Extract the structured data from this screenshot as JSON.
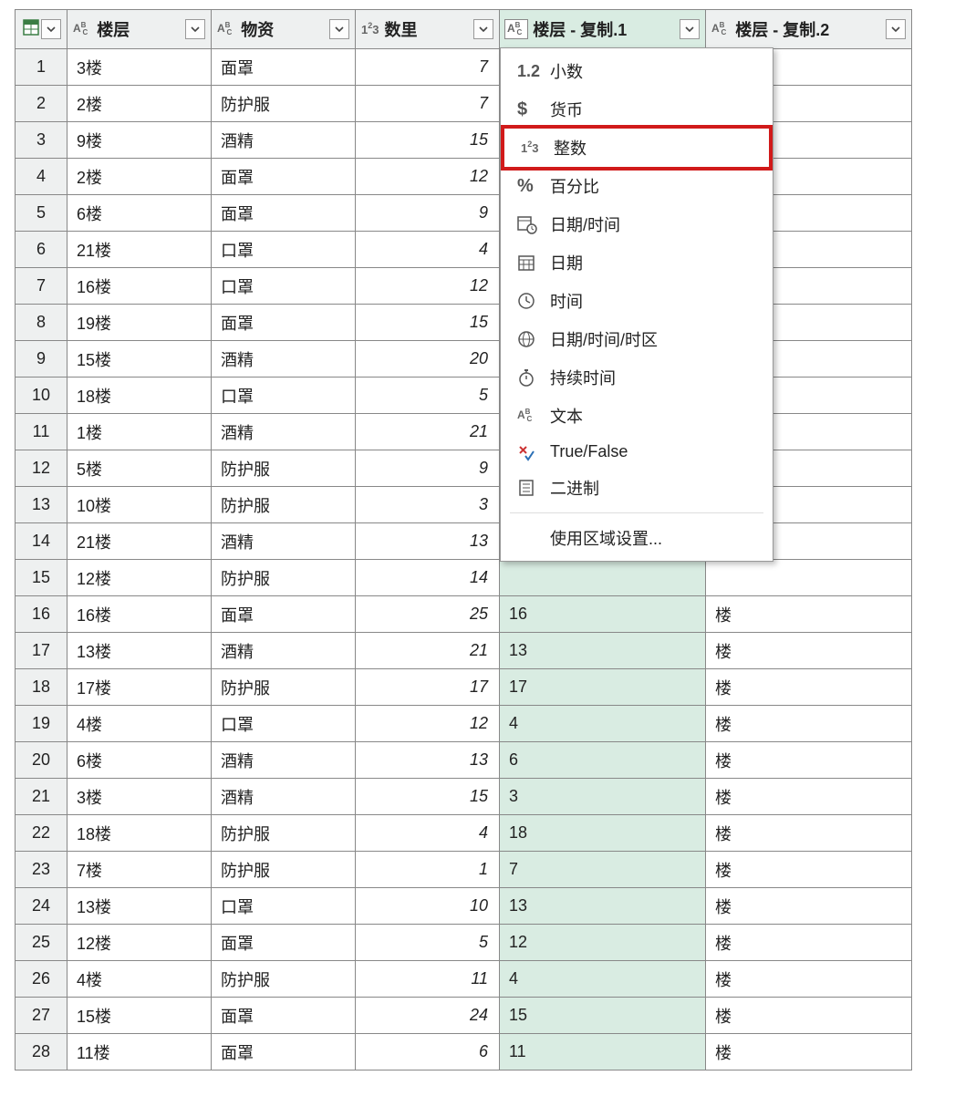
{
  "columns": [
    {
      "id": "rowindex",
      "label": "",
      "type_icon": "table"
    },
    {
      "id": "floor",
      "label": "楼层",
      "type_icon": "abc"
    },
    {
      "id": "supplies",
      "label": "物资",
      "type_icon": "abc"
    },
    {
      "id": "qty",
      "label": "数里",
      "type_icon": "num"
    },
    {
      "id": "floor_c1",
      "label": "楼层 - 复制.1",
      "type_icon": "abc",
      "selected": true,
      "type_picker_open": true
    },
    {
      "id": "floor_c2",
      "label": "楼层 - 复制.2",
      "type_icon": "abc"
    }
  ],
  "rows": [
    {
      "n": 1,
      "floor": "3楼",
      "supplies": "面罩",
      "qty": 7,
      "c1": "",
      "c2": ""
    },
    {
      "n": 2,
      "floor": "2楼",
      "supplies": "防护服",
      "qty": 7,
      "c1": "",
      "c2": ""
    },
    {
      "n": 3,
      "floor": "9楼",
      "supplies": "酒精",
      "qty": 15,
      "c1": "",
      "c2": ""
    },
    {
      "n": 4,
      "floor": "2楼",
      "supplies": "面罩",
      "qty": 12,
      "c1": "",
      "c2": ""
    },
    {
      "n": 5,
      "floor": "6楼",
      "supplies": "面罩",
      "qty": 9,
      "c1": "",
      "c2": ""
    },
    {
      "n": 6,
      "floor": "21楼",
      "supplies": "口罩",
      "qty": 4,
      "c1": "",
      "c2": ""
    },
    {
      "n": 7,
      "floor": "16楼",
      "supplies": "口罩",
      "qty": 12,
      "c1": "",
      "c2": ""
    },
    {
      "n": 8,
      "floor": "19楼",
      "supplies": "面罩",
      "qty": 15,
      "c1": "",
      "c2": ""
    },
    {
      "n": 9,
      "floor": "15楼",
      "supplies": "酒精",
      "qty": 20,
      "c1": "",
      "c2": ""
    },
    {
      "n": 10,
      "floor": "18楼",
      "supplies": "口罩",
      "qty": 5,
      "c1": "",
      "c2": ""
    },
    {
      "n": 11,
      "floor": "1楼",
      "supplies": "酒精",
      "qty": 21,
      "c1": "",
      "c2": ""
    },
    {
      "n": 12,
      "floor": "5楼",
      "supplies": "防护服",
      "qty": 9,
      "c1": "",
      "c2": ""
    },
    {
      "n": 13,
      "floor": "10楼",
      "supplies": "防护服",
      "qty": 3,
      "c1": "",
      "c2": ""
    },
    {
      "n": 14,
      "floor": "21楼",
      "supplies": "酒精",
      "qty": 13,
      "c1": "",
      "c2": ""
    },
    {
      "n": 15,
      "floor": "12楼",
      "supplies": "防护服",
      "qty": 14,
      "c1": "",
      "c2": ""
    },
    {
      "n": 16,
      "floor": "16楼",
      "supplies": "面罩",
      "qty": 25,
      "c1": "16",
      "c2": "楼"
    },
    {
      "n": 17,
      "floor": "13楼",
      "supplies": "酒精",
      "qty": 21,
      "c1": "13",
      "c2": "楼"
    },
    {
      "n": 18,
      "floor": "17楼",
      "supplies": "防护服",
      "qty": 17,
      "c1": "17",
      "c2": "楼"
    },
    {
      "n": 19,
      "floor": "4楼",
      "supplies": "口罩",
      "qty": 12,
      "c1": "4",
      "c2": "楼"
    },
    {
      "n": 20,
      "floor": "6楼",
      "supplies": "酒精",
      "qty": 13,
      "c1": "6",
      "c2": "楼"
    },
    {
      "n": 21,
      "floor": "3楼",
      "supplies": "酒精",
      "qty": 15,
      "c1": "3",
      "c2": "楼"
    },
    {
      "n": 22,
      "floor": "18楼",
      "supplies": "防护服",
      "qty": 4,
      "c1": "18",
      "c2": "楼"
    },
    {
      "n": 23,
      "floor": "7楼",
      "supplies": "防护服",
      "qty": 1,
      "c1": "7",
      "c2": "楼"
    },
    {
      "n": 24,
      "floor": "13楼",
      "supplies": "口罩",
      "qty": 10,
      "c1": "13",
      "c2": "楼"
    },
    {
      "n": 25,
      "floor": "12楼",
      "supplies": "面罩",
      "qty": 5,
      "c1": "12",
      "c2": "楼"
    },
    {
      "n": 26,
      "floor": "4楼",
      "supplies": "防护服",
      "qty": 11,
      "c1": "4",
      "c2": "楼"
    },
    {
      "n": 27,
      "floor": "15楼",
      "supplies": "面罩",
      "qty": 24,
      "c1": "15",
      "c2": "楼"
    },
    {
      "n": 28,
      "floor": "11楼",
      "supplies": "面罩",
      "qty": 6,
      "c1": "11",
      "c2": "楼"
    }
  ],
  "type_menu": {
    "items": [
      {
        "id": "decimal",
        "icon": "1.2",
        "label": "小数"
      },
      {
        "id": "currency",
        "icon": "$",
        "label": "货币"
      },
      {
        "id": "integer",
        "icon": "123",
        "label": "整数",
        "highlighted": true
      },
      {
        "id": "percent",
        "icon": "%",
        "label": "百分比"
      },
      {
        "id": "datetime",
        "icon": "calclock",
        "label": "日期/时间"
      },
      {
        "id": "date",
        "icon": "cal",
        "label": "日期"
      },
      {
        "id": "time",
        "icon": "clock",
        "label": "时间"
      },
      {
        "id": "datetimetz",
        "icon": "globe",
        "label": "日期/时间/时区"
      },
      {
        "id": "duration",
        "icon": "stopwatch",
        "label": "持续时间"
      },
      {
        "id": "text",
        "icon": "abc",
        "label": "文本"
      },
      {
        "id": "bool",
        "icon": "tf",
        "label": "True/False"
      },
      {
        "id": "binary",
        "icon": "list",
        "label": "二进制"
      },
      {
        "id": "sep"
      },
      {
        "id": "locale",
        "icon": "",
        "label": "使用区域设置..."
      }
    ]
  }
}
